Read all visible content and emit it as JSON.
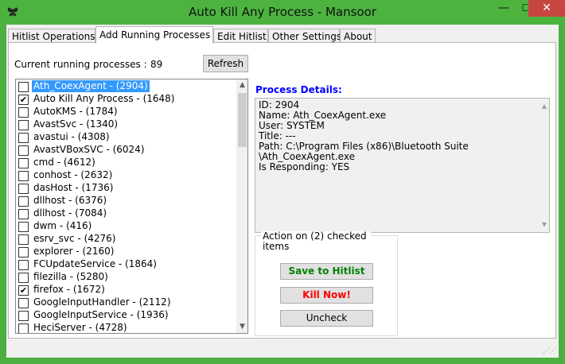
{
  "window": {
    "title": "Auto Kill Any Process - Mansoor",
    "icon": "butterfly-icon",
    "controls": {
      "minimize": "—",
      "maximize": "☐",
      "close": "✕"
    }
  },
  "tabs": [
    {
      "label": "Hitlist Operations"
    },
    {
      "label": "Add Running Processes"
    },
    {
      "label": "Edit Hitlist"
    },
    {
      "label": "Other Settings"
    },
    {
      "label": "About"
    }
  ],
  "processes": {
    "count_label": "Current running processes :",
    "count_value": "89",
    "refresh_label": "Refresh",
    "items": [
      {
        "label": "Ath_CoexAgent - (2904)",
        "checked": false,
        "selected": true
      },
      {
        "label": "Auto Kill Any Process - (1648)",
        "checked": true,
        "selected": false
      },
      {
        "label": "AutoKMS - (1784)",
        "checked": false,
        "selected": false
      },
      {
        "label": "AvastSvc - (1340)",
        "checked": false,
        "selected": false
      },
      {
        "label": "avastui - (4308)",
        "checked": false,
        "selected": false
      },
      {
        "label": "AvastVBoxSVC - (6024)",
        "checked": false,
        "selected": false
      },
      {
        "label": "cmd - (4612)",
        "checked": false,
        "selected": false
      },
      {
        "label": "conhost - (2632)",
        "checked": false,
        "selected": false
      },
      {
        "label": "dasHost - (1736)",
        "checked": false,
        "selected": false
      },
      {
        "label": "dllhost - (6376)",
        "checked": false,
        "selected": false
      },
      {
        "label": "dllhost - (7084)",
        "checked": false,
        "selected": false
      },
      {
        "label": "dwm - (416)",
        "checked": false,
        "selected": false
      },
      {
        "label": "esrv_svc - (4276)",
        "checked": false,
        "selected": false
      },
      {
        "label": "explorer - (2160)",
        "checked": false,
        "selected": false
      },
      {
        "label": "FCUpdateService - (1864)",
        "checked": false,
        "selected": false
      },
      {
        "label": "filezilla - (5280)",
        "checked": false,
        "selected": false
      },
      {
        "label": "firefox - (1672)",
        "checked": true,
        "selected": false
      },
      {
        "label": "GoogleInputHandler - (2112)",
        "checked": false,
        "selected": false
      },
      {
        "label": "GoogleInputService - (1936)",
        "checked": false,
        "selected": false
      },
      {
        "label": "HeciServer - (4728)",
        "checked": false,
        "selected": false
      }
    ]
  },
  "details": {
    "title": "Process Details:",
    "lines": [
      "ID: 2904",
      "Name: Ath_CoexAgent.exe",
      "User: SYSTEM",
      "Title: ---",
      "Path: C:\\Program Files (x86)\\Bluetooth Suite",
      "\\Ath_CoexAgent.exe",
      "Is Responding: YES"
    ]
  },
  "actions": {
    "caption": "Action on (2) checked items",
    "save_label": "Save to Hitlist",
    "kill_label": "Kill Now!",
    "uncheck_label": "Uncheck"
  },
  "colors": {
    "titlebar": "#4cb33f",
    "close": "#c7463f",
    "selection": "#3399ff",
    "details_title": "#0000ff",
    "save": "#008000",
    "kill": "#ff0000"
  }
}
